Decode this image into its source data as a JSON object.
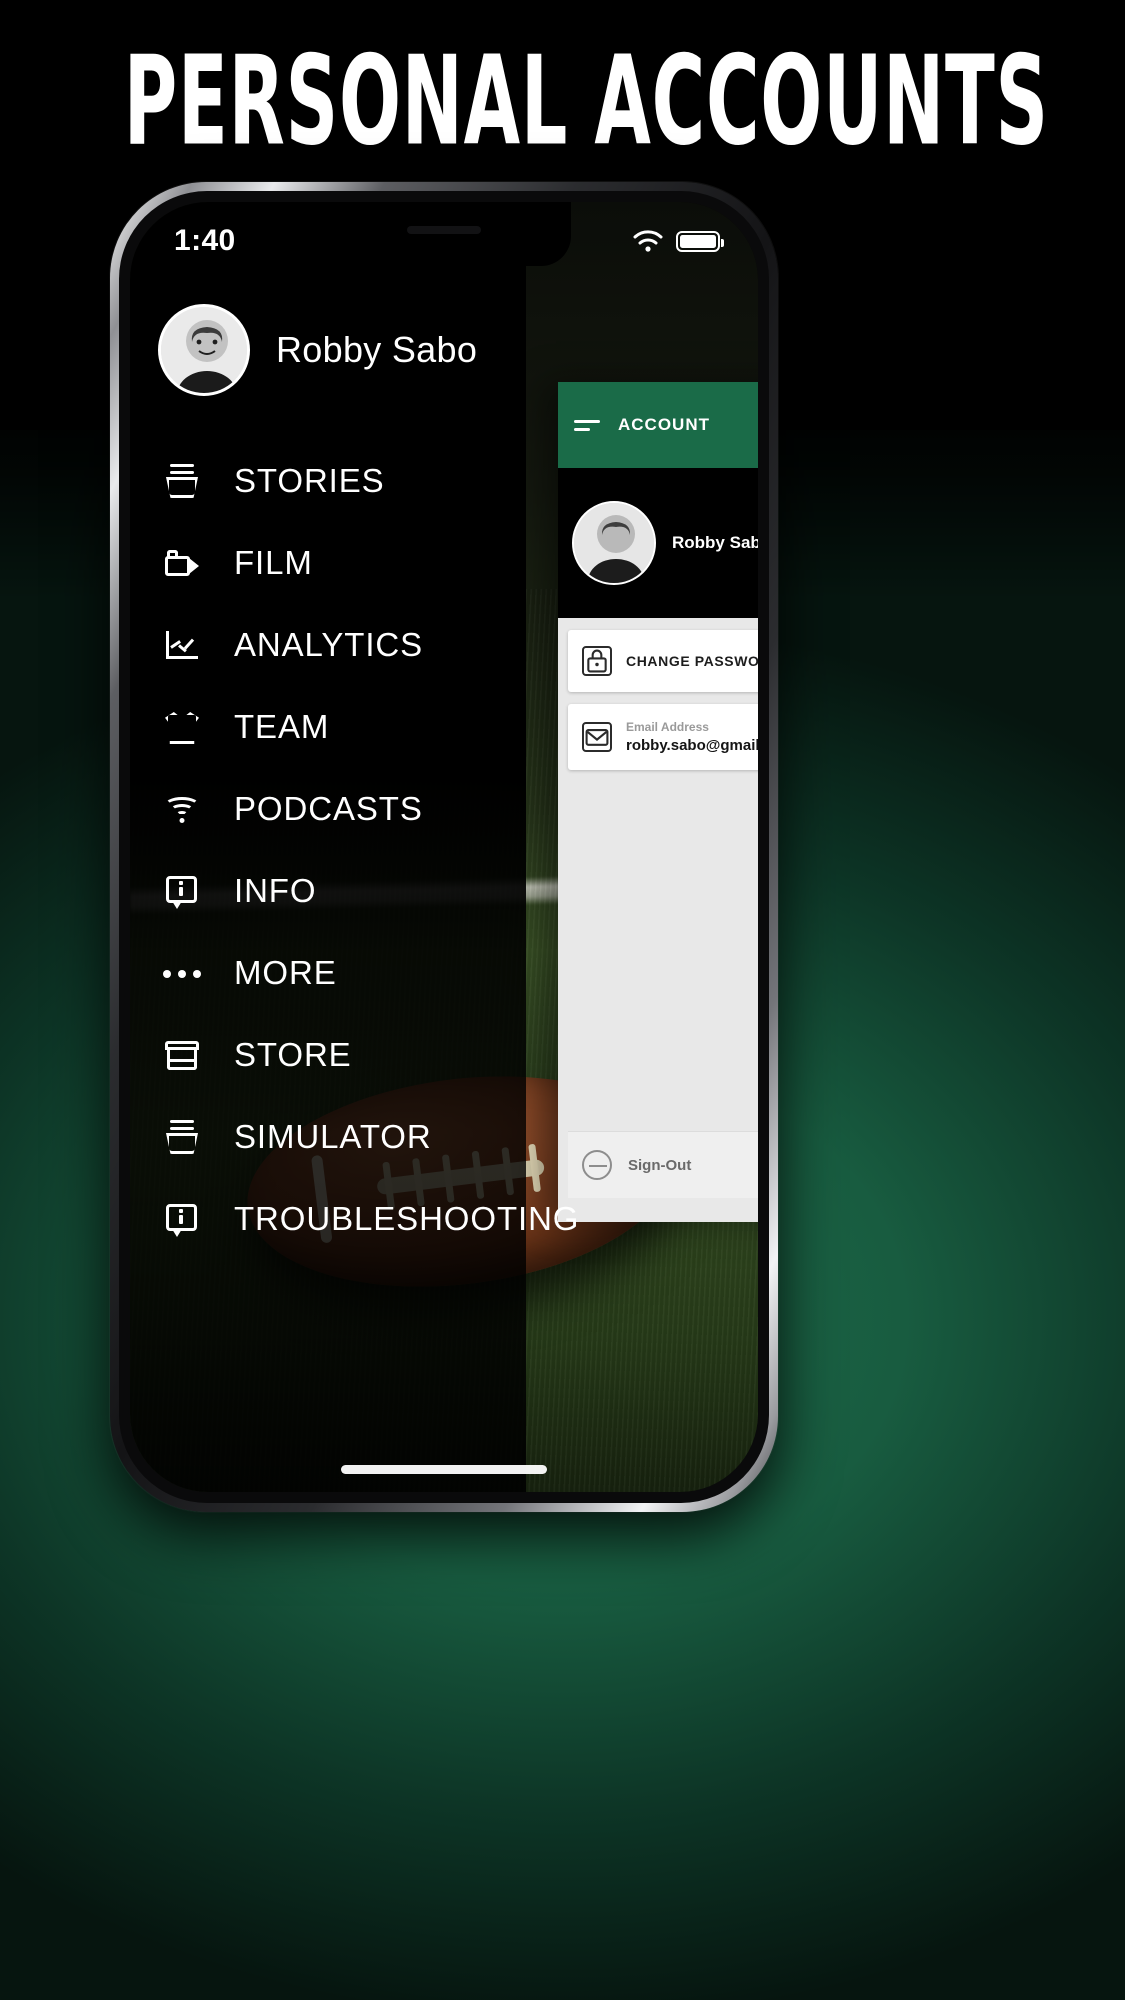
{
  "headline": "PERSONAL ACCOUNTS",
  "colors": {
    "brand_green": "#1a6b48",
    "background_green": "#14543b",
    "black": "#000000",
    "white": "#ffffff"
  },
  "status_bar": {
    "time": "1:40",
    "wifi_icon": "wifi-icon",
    "battery_icon": "battery-icon"
  },
  "drawer": {
    "profile": {
      "name": "Robby Sabo",
      "avatar_icon": "avatar"
    },
    "items": [
      {
        "label": "STORIES",
        "icon": "stack-icon"
      },
      {
        "label": "FILM",
        "icon": "video-camera-icon"
      },
      {
        "label": "ANALYTICS",
        "icon": "line-chart-icon"
      },
      {
        "label": "TEAM",
        "icon": "jersey-icon"
      },
      {
        "label": "PODCASTS",
        "icon": "wifi-broadcast-icon"
      },
      {
        "label": "INFO",
        "icon": "info-bubble-icon"
      },
      {
        "label": "MORE",
        "icon": "ellipsis-icon"
      },
      {
        "label": "STORE",
        "icon": "store-icon"
      },
      {
        "label": "SIMULATOR",
        "icon": "stack-icon"
      },
      {
        "label": "TROUBLESHOOTING",
        "icon": "info-bubble-icon"
      }
    ]
  },
  "account_panel": {
    "header": {
      "title": "ACCOUNT",
      "menu_icon": "hamburger-icon"
    },
    "profile": {
      "name": "Robby Sabo",
      "avatar_icon": "avatar"
    },
    "change_password": {
      "label": "CHANGE PASSWORD",
      "icon": "lock-icon"
    },
    "email": {
      "sub_label": "Email Address",
      "value": "robby.sabo@gmail.com",
      "icon": "envelope-icon"
    },
    "sign_out": {
      "label": "Sign-Out",
      "icon": "sign-out-icon"
    }
  }
}
